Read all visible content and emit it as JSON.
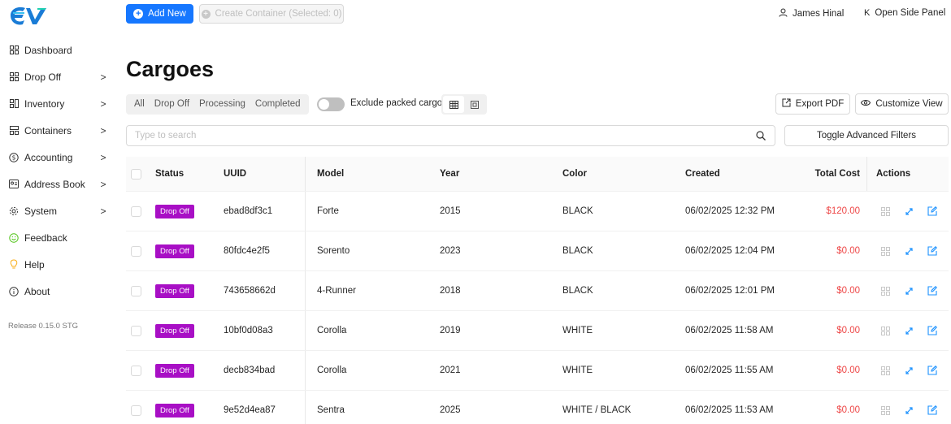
{
  "colors": {
    "primary": "#1677ff",
    "badge": "#a80fc5",
    "cost": "#ee4747",
    "action_icon": "#1890ff"
  },
  "sidebar": {
    "logo": "EV",
    "items": [
      {
        "label": "Dashboard",
        "icon": "grid-icon",
        "chevron": ""
      },
      {
        "label": "Drop Off",
        "icon": "grid-icon",
        "chevron": ">"
      },
      {
        "label": "Inventory",
        "icon": "inventory-icon",
        "chevron": ">"
      },
      {
        "label": "Containers",
        "icon": "container-icon",
        "chevron": ">"
      },
      {
        "label": "Accounting",
        "icon": "dollar-icon",
        "chevron": ">"
      },
      {
        "label": "Address Book",
        "icon": "address-book-icon",
        "chevron": ">"
      },
      {
        "label": "System",
        "icon": "gear-icon",
        "chevron": ">"
      },
      {
        "label": "Feedback",
        "icon": "smile-icon",
        "chevron": ""
      },
      {
        "label": "Help",
        "icon": "bulb-icon",
        "chevron": ""
      },
      {
        "label": "About",
        "icon": "info-icon",
        "chevron": ""
      }
    ],
    "release": "Release 0.15.0 STG"
  },
  "topbar": {
    "add_label": "Add New",
    "create_label": "Create Container (Selected: 0)",
    "user_name": "James Hinal",
    "side_panel_label": "Open Side Panel"
  },
  "page": {
    "title": "Cargoes",
    "filters": [
      "All",
      "Drop Off",
      "Processing",
      "Completed"
    ],
    "toggle_label": "Exclude packed cargo",
    "export_label": "Export PDF",
    "customize_label": "Customize View",
    "search_placeholder": "Type to search",
    "advanced_filters_label": "Toggle Advanced Filters"
  },
  "table": {
    "headers": {
      "status": "Status",
      "uuid": "UUID",
      "model": "Model",
      "year": "Year",
      "color": "Color",
      "created": "Created",
      "total": "Total Cost",
      "actions": "Actions"
    },
    "rows": [
      {
        "status": "Drop Off",
        "uuid": "ebad8df3c1",
        "model": "Forte",
        "year": "2015",
        "color": "BLACK",
        "created": "06/02/2025 12:32 PM",
        "total": "$120.00"
      },
      {
        "status": "Drop Off",
        "uuid": "80fdc4e2f5",
        "model": "Sorento",
        "year": "2023",
        "color": "BLACK",
        "created": "06/02/2025 12:04 PM",
        "total": "$0.00"
      },
      {
        "status": "Drop Off",
        "uuid": "743658662d",
        "model": "4-Runner",
        "year": "2018",
        "color": "BLACK",
        "created": "06/02/2025 12:01 PM",
        "total": "$0.00"
      },
      {
        "status": "Drop Off",
        "uuid": "10bf0d08a3",
        "model": "Corolla",
        "year": "2019",
        "color": "WHITE",
        "created": "06/02/2025 11:58 AM",
        "total": "$0.00"
      },
      {
        "status": "Drop Off",
        "uuid": "decb834bad",
        "model": "Corolla",
        "year": "2021",
        "color": "WHITE",
        "created": "06/02/2025 11:55 AM",
        "total": "$0.00"
      },
      {
        "status": "Drop Off",
        "uuid": "9e52d4ea87",
        "model": "Sentra",
        "year": "2025",
        "color": "WHITE / BLACK",
        "created": "06/02/2025 11:53 AM",
        "total": "$0.00"
      }
    ]
  }
}
